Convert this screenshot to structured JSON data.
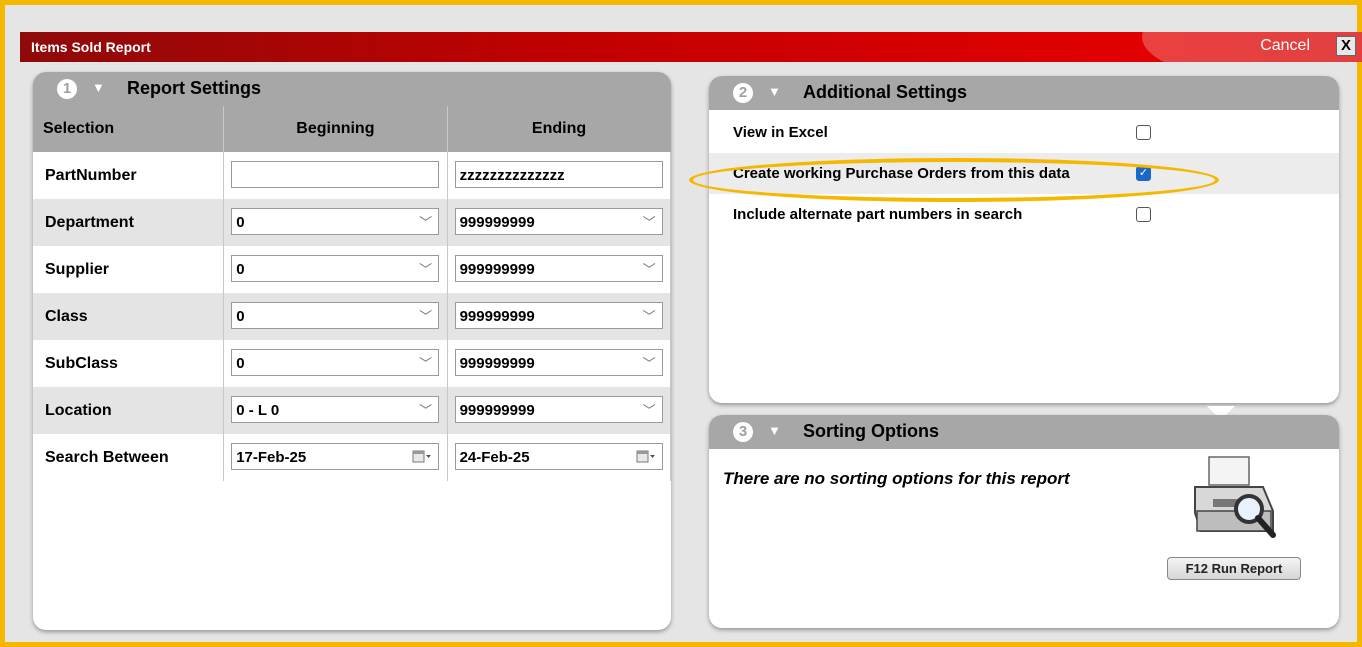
{
  "window": {
    "title": "Items Sold Report",
    "cancel_label": "Cancel",
    "close_label": "X"
  },
  "report_settings": {
    "number": "1",
    "title": "Report Settings",
    "columns": [
      "Selection",
      "Beginning",
      "Ending"
    ],
    "rows": [
      {
        "label": "PartNumber",
        "beginning": "",
        "ending": "zzzzzzzzzzzzzz"
      },
      {
        "label": "Department",
        "beginning": "0",
        "ending": "999999999"
      },
      {
        "label": "Supplier",
        "beginning": "0",
        "ending": "999999999"
      },
      {
        "label": "Class",
        "beginning": "0",
        "ending": "999999999"
      },
      {
        "label": "SubClass",
        "beginning": "0",
        "ending": "999999999"
      },
      {
        "label": "Location",
        "beginning": "0 - L 0",
        "ending": "999999999"
      },
      {
        "label": "Search Between",
        "beginning": "17-Feb-25",
        "ending": "24-Feb-25"
      }
    ]
  },
  "additional_settings": {
    "number": "2",
    "title": "Additional Settings",
    "options": [
      {
        "label": "View in Excel",
        "checked": false
      },
      {
        "label": "Create working Purchase Orders from this data",
        "checked": true
      },
      {
        "label": "Include alternate part numbers in search",
        "checked": false
      }
    ]
  },
  "sorting_options": {
    "number": "3",
    "title": "Sorting Options",
    "message": "There are no sorting options for this report",
    "run_button": "F12  Run Report"
  },
  "colors": {
    "title_bar": "#c00000",
    "highlight": "#f5b800",
    "header_gray": "#a7a7a7",
    "checkbox_checked": "#1c68c8"
  }
}
